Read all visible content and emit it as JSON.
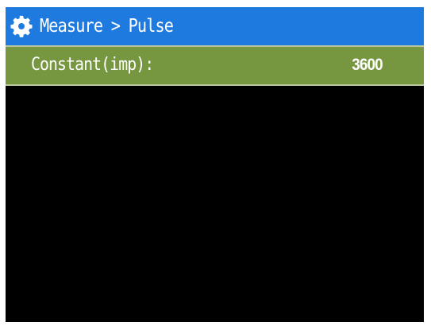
{
  "colors": {
    "titlebar_bg": "#1f7ae0",
    "selected_row_bg": "#76963f",
    "screen_bg": "#000000",
    "text": "#ffffff"
  },
  "header": {
    "icon": "gear-icon",
    "breadcrumb": [
      "Measure",
      "Pulse"
    ],
    "separator": ">"
  },
  "settings": [
    {
      "label": "Constant(imp):",
      "value": "3600",
      "selected": true
    }
  ]
}
